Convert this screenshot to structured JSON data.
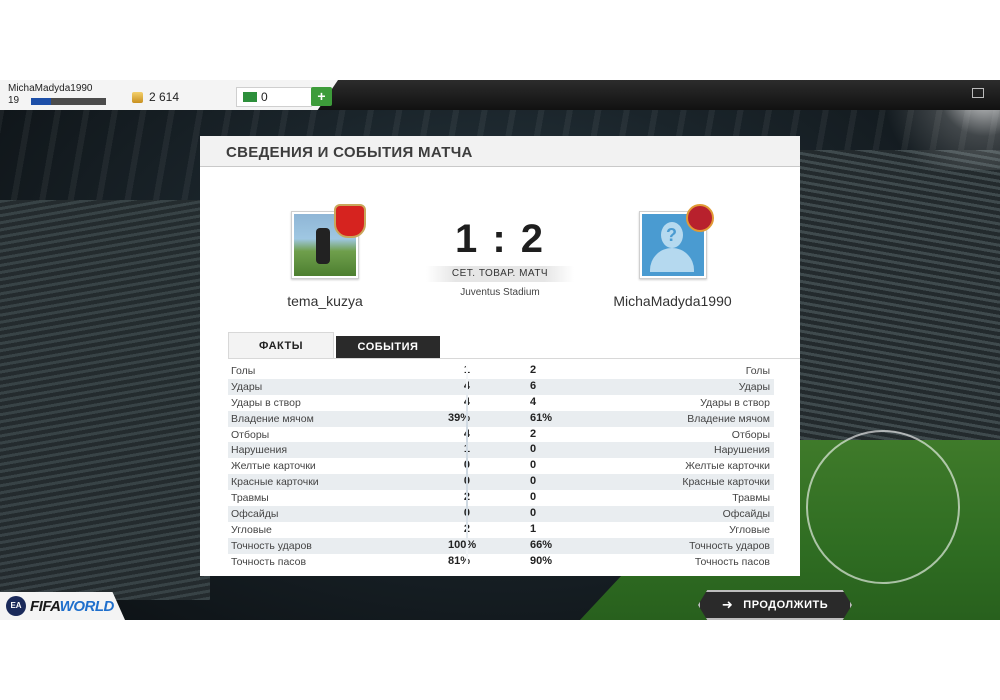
{
  "header": {
    "username": "MichaMadyda1990",
    "level": "19",
    "xp_progress": 0.26,
    "coins": "2 614",
    "cash": "0",
    "add_label": "+"
  },
  "panel": {
    "title": "СВЕДЕНИЯ И СОБЫТИЯ МАТЧА",
    "home_team": "tema_kuzya",
    "away_team": "MichaMadyda1990",
    "home_crest_text": "Arsenal",
    "score": "1 : 2",
    "match_type": "СЕТ. ТОВАР. МАТЧ",
    "venue": "Juventus Stadium"
  },
  "tabs": {
    "facts": "ФАКТЫ",
    "events": "СОБЫТИЯ"
  },
  "stats": [
    {
      "label": "Голы",
      "home": "1",
      "away": "2"
    },
    {
      "label": "Удары",
      "home": "4",
      "away": "6"
    },
    {
      "label": "Удары в створ",
      "home": "4",
      "away": "4"
    },
    {
      "label": "Владение мячом",
      "home": "39%",
      "away": "61%"
    },
    {
      "label": "Отборы",
      "home": "4",
      "away": "2"
    },
    {
      "label": "Нарушения",
      "home": "1",
      "away": "0"
    },
    {
      "label": "Желтые карточки",
      "home": "0",
      "away": "0"
    },
    {
      "label": "Красные карточки",
      "home": "0",
      "away": "0"
    },
    {
      "label": "Травмы",
      "home": "2",
      "away": "0"
    },
    {
      "label": "Офсайды",
      "home": "0",
      "away": "0"
    },
    {
      "label": "Угловые",
      "home": "2",
      "away": "1"
    },
    {
      "label": "Точность ударов",
      "home": "100%",
      "away": "66%"
    },
    {
      "label": "Точность пасов",
      "home": "81%",
      "away": "90%"
    }
  ],
  "footer": {
    "ea_label": "EA",
    "logo_fifa": "FIFA",
    "logo_world": "WORLD",
    "continue_label": "ПРОДОЛЖИТЬ"
  }
}
